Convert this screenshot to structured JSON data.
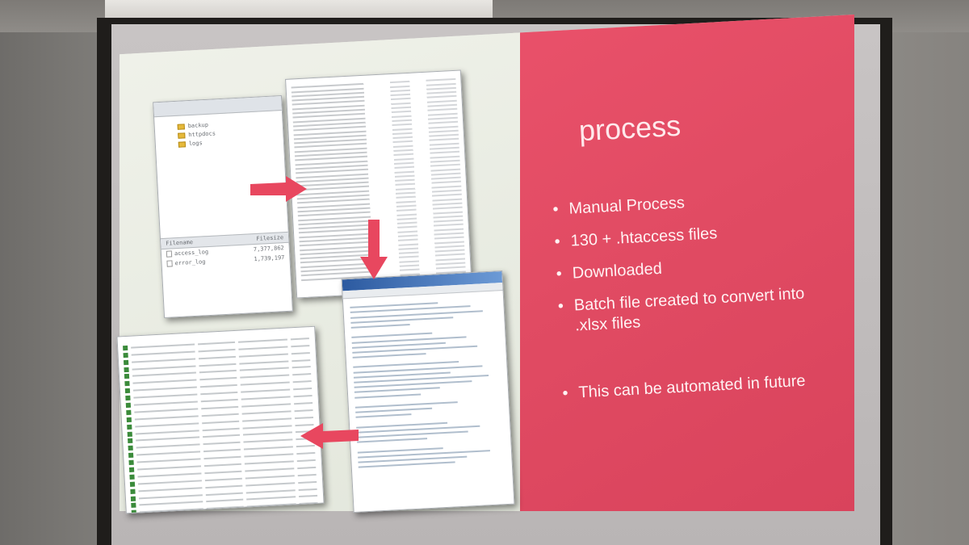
{
  "slide": {
    "title": "process",
    "bullets": [
      "Manual Process",
      "130 + .htaccess files",
      "Downloaded",
      "Batch file created to convert into .xlsx files",
      "This can be automated in future"
    ]
  },
  "ftp_window": {
    "folders": [
      "backup",
      "httpdocs",
      "logs"
    ],
    "column_filename": "Filename",
    "column_filesize": "Filesize",
    "files": [
      {
        "name": "access_log",
        "size": "7,377,862"
      },
      {
        "name": "error_log",
        "size": "1,739,197"
      }
    ]
  },
  "colors": {
    "accent": "#e14b63",
    "arrow": "#e8475f"
  }
}
